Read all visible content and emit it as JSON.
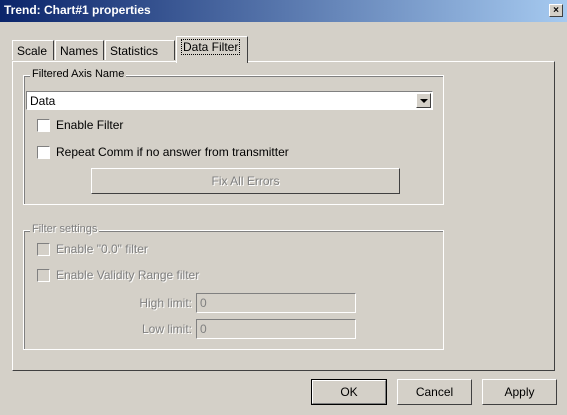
{
  "window": {
    "title": "Trend: Chart#1 properties",
    "close_glyph": "×"
  },
  "tabs": [
    {
      "label": "Scale"
    },
    {
      "label": "Names"
    },
    {
      "label": "Statistics"
    },
    {
      "label": "Data Filter"
    }
  ],
  "filtered_axis": {
    "group_label": "Filtered Axis Name",
    "selected_value": "Data",
    "enable_filter_label": "Enable Filter",
    "repeat_comm_label": "Repeat Comm if no answer from transmitter",
    "fix_errors_label": "Fix All Errors"
  },
  "filter_settings": {
    "group_label": "Filter settings",
    "enable_00_label": "Enable \"0.0\" filter",
    "enable_validity_label": "Enable Validity Range filter",
    "high_limit_label": "High limit:",
    "high_limit_value": "0",
    "low_limit_label": "Low limit:",
    "low_limit_value": "0"
  },
  "buttons": {
    "ok": "OK",
    "cancel": "Cancel",
    "apply": "Apply"
  }
}
